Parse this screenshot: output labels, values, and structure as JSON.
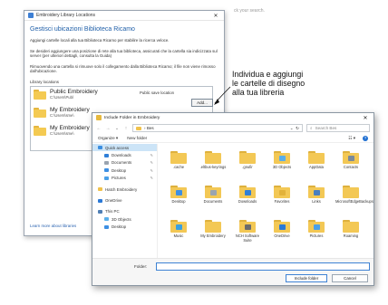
{
  "background_hint": "ck your search.",
  "library_dialog": {
    "title": "Embroidery Library Locations",
    "close_glyph": "✕",
    "heading": "Gestisci ubicazioni Biblioteca Ricamo",
    "p1": "Aggiungi cartelle locali alla tua Biblioteca Ricamo per stabilire la ricerca veloce.",
    "p2": "Se desideri aggiungere una posizione di rete alla tua biblioteca, assicurati che la cartella sia indicizzata sul server (per ulteriori dettagli, consulta la Guida)",
    "p3": "Rimuovendo una cartella si rimuove solo il collegamento dalla Biblioteca Ricamo; il file non viene rimosso dall'ubicazione.",
    "locations_label": "Library locations",
    "locations": [
      {
        "name": "Public Embroidery",
        "path": "C:\\Users\\Publ",
        "tag": "Public save location"
      },
      {
        "name": "My Embroidery",
        "path": "C:\\Users\\sme\\",
        "tag": ""
      },
      {
        "name": "My Embroidery",
        "path": "C:\\Users\\sme\\",
        "tag": ""
      }
    ],
    "add_label": "Add...",
    "learn_more": "Learn more about libraries"
  },
  "callout": {
    "line1": "Individua e aggiungi",
    "line2": "le cartelle di disegno",
    "line3": "alla tua libreria"
  },
  "include_dialog": {
    "title": "Include Folder in Embroidery",
    "close_glyph": "✕",
    "address": "Bes",
    "search_placeholder": "Search Bes",
    "organize": "Organize ▾",
    "new_folder": "New folder",
    "nav": [
      {
        "label": "Quick access",
        "color": "#3b8ee0",
        "indent": false,
        "selected": true,
        "pin": ""
      },
      {
        "label": "Downloads",
        "color": "#2f7fd8",
        "indent": true,
        "selected": false,
        "pin": "✎"
      },
      {
        "label": "Documents",
        "color": "#9aa4b0",
        "indent": true,
        "selected": false,
        "pin": "✎"
      },
      {
        "label": "Desktop",
        "color": "#3d8fe3",
        "indent": true,
        "selected": false,
        "pin": "✎"
      },
      {
        "label": "Pictures",
        "color": "#4aa0e8",
        "indent": true,
        "selected": false,
        "pin": "✎"
      },
      {
        "label": "",
        "color": "",
        "indent": false,
        "selected": false,
        "pin": ""
      },
      {
        "label": "Hatch Embroidery",
        "color": "#f0c24c",
        "indent": false,
        "selected": false,
        "pin": ""
      },
      {
        "label": "",
        "color": "",
        "indent": false,
        "selected": false,
        "pin": ""
      },
      {
        "label": "OneDrive",
        "color": "#2b79d6",
        "indent": false,
        "selected": false,
        "pin": ""
      },
      {
        "label": "",
        "color": "",
        "indent": false,
        "selected": false,
        "pin": ""
      },
      {
        "label": "This PC",
        "color": "#4f7fb5",
        "indent": false,
        "selected": false,
        "pin": ""
      },
      {
        "label": "3D Objects",
        "color": "#5ab0ea",
        "indent": true,
        "selected": false,
        "pin": ""
      },
      {
        "label": "Desktop",
        "color": "#3d8fe3",
        "indent": true,
        "selected": false,
        "pin": ""
      }
    ],
    "folders": [
      {
        "label": ".cache",
        "emblem": ""
      },
      {
        "label": ".eltbus-keyrings",
        "emblem": ""
      },
      {
        "label": ".gnufir",
        "emblem": ""
      },
      {
        "label": "3D Objects",
        "emblem": "#5aaee8"
      },
      {
        "label": "AppData",
        "emblem": ""
      },
      {
        "label": "Contacts",
        "emblem": "#7a8a9a"
      },
      {
        "label": "Desktop",
        "emblem": "#3d8fe3"
      },
      {
        "label": "Documents",
        "emblem": "#9aa4b0"
      },
      {
        "label": "Downloads",
        "emblem": "#2f7fd8"
      },
      {
        "label": "Favorites",
        "emblem": "#e2b23a"
      },
      {
        "label": "Links",
        "emblem": "#4a7fc0"
      },
      {
        "label": "MicrosoftEdgeBackups",
        "emblem": ""
      },
      {
        "label": "Music",
        "emblem": "#3aa0e0"
      },
      {
        "label": "My Embroidery",
        "emblem": ""
      },
      {
        "label": "NCH Software Suite",
        "emblem": "#6b6b6b"
      },
      {
        "label": "OneDrive",
        "emblem": "#2b79d6"
      },
      {
        "label": "Pictures",
        "emblem": "#4aa0e8"
      },
      {
        "label": "Roaming",
        "emblem": ""
      }
    ],
    "folder_label": "Folder:",
    "folder_value": "",
    "include_button": "Include folder",
    "cancel_button": "Cancel"
  }
}
